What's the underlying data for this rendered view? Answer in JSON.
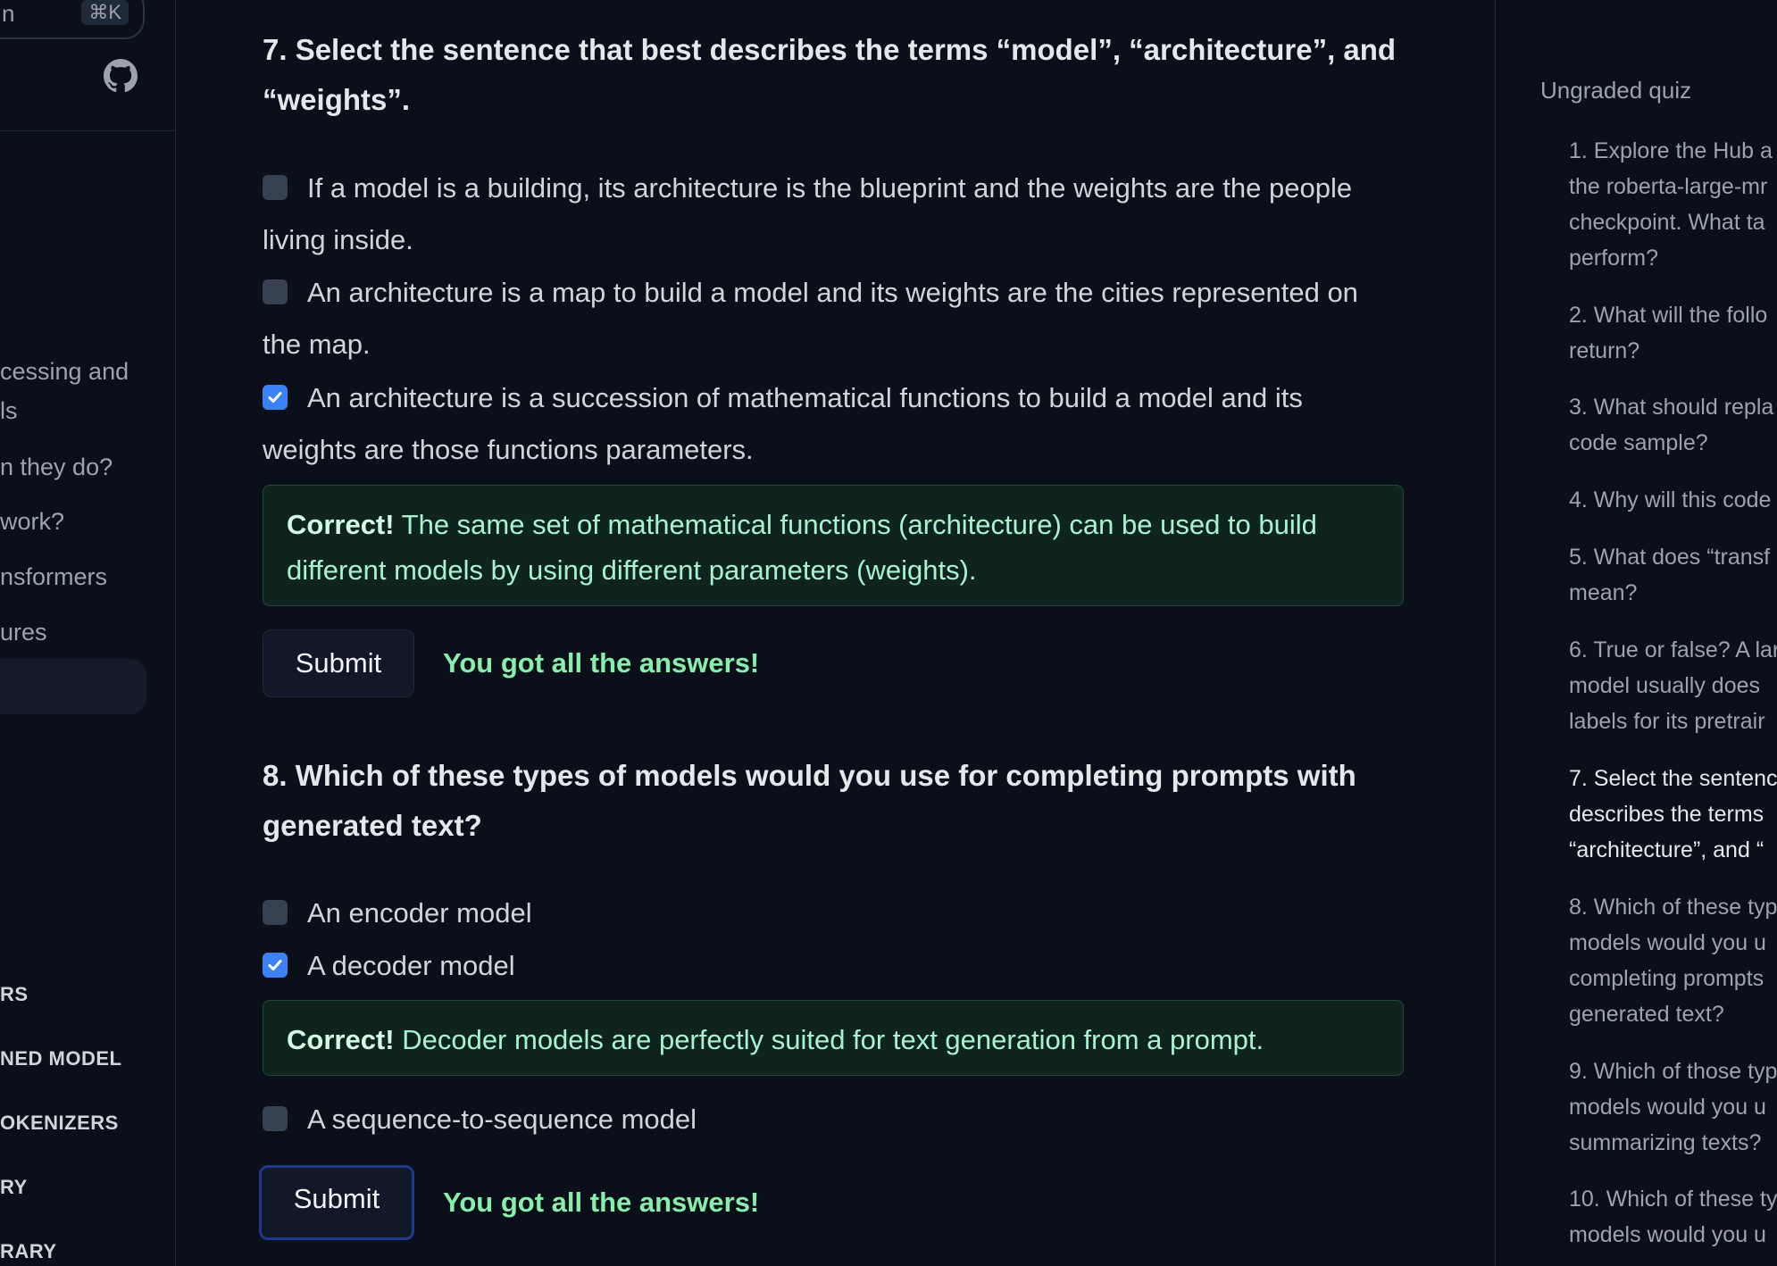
{
  "sidebar": {
    "search": {
      "text": "n",
      "shortcut": "⌘K"
    },
    "nav_items": [
      "cessing and",
      "ls",
      "n they do?",
      "work?",
      "nsformers",
      "ures"
    ],
    "sections": [
      "RS",
      "NED MODEL",
      "OKENIZERS",
      "RY",
      "RARY"
    ],
    "icons": {
      "repo_link": "github-icon"
    }
  },
  "main": {
    "q7": {
      "title_line1": "7. Select the sentence that best describes the terms “model”, “architecture”, and",
      "title_line2": "“weights”.",
      "options": [
        {
          "line1": "If a model is a building, its architecture is the blueprint and the weights are the people",
          "line2": "living inside.",
          "checked": false
        },
        {
          "line1": "An architecture is a map to build a model and its weights are the cities represented on",
          "line2": "the map.",
          "checked": false
        },
        {
          "line1": "An architecture is a succession of mathematical functions to build a model and its",
          "line2": "weights are those functions parameters.",
          "checked": true
        }
      ],
      "feedback": {
        "label": "Correct!",
        "line1": " The same set of mathematical functions (architecture) can be used to build",
        "line2": "different models by using different parameters (weights)."
      },
      "submit_label": "Submit",
      "result": "You got all the answers!"
    },
    "q8": {
      "title_line1": "8. Which of these types of models would you use for completing prompts with",
      "title_line2": "generated text?",
      "options": [
        {
          "label": "An encoder model",
          "checked": false
        },
        {
          "label": "A decoder model",
          "checked": true
        },
        {
          "label": "A sequence-to-sequence model",
          "checked": false
        }
      ],
      "feedback": {
        "label": "Correct!",
        "text": " Decoder models are perfectly suited for text generation from a prompt."
      },
      "submit_label": "Submit",
      "result": "You got all the answers!"
    }
  },
  "toc": {
    "heading": "Ungraded quiz",
    "items": [
      {
        "lines": [
          "1. Explore the Hub a",
          "the roberta-large-mr",
          "checkpoint. What ta",
          "perform?"
        ]
      },
      {
        "lines": [
          "2. What will the follo",
          "return?"
        ]
      },
      {
        "lines": [
          "3. What should repla",
          "code sample?"
        ]
      },
      {
        "lines": [
          "4. Why will this code"
        ]
      },
      {
        "lines": [
          "5. What does “transf",
          "mean?"
        ]
      },
      {
        "lines": [
          "6. True or false? A lar",
          "model usually does",
          "labels for its pretrair"
        ]
      },
      {
        "lines": [
          "7. Select the sentenc",
          "describes the terms",
          "“architecture”, and “"
        ],
        "active": true
      },
      {
        "lines": [
          "8. Which of these typ",
          "models would you u",
          "completing prompts",
          "generated text?"
        ]
      },
      {
        "lines": [
          "9. Which of those typ",
          "models would you u",
          "summarizing texts?"
        ]
      },
      {
        "lines": [
          "10. Which of these ty",
          "models would you u"
        ]
      }
    ]
  },
  "colors": {
    "background": "#0b0f19",
    "checkbox_checked": "#3b82f6",
    "success_text": "#86efac",
    "feedback_bg": "#0f241f"
  }
}
